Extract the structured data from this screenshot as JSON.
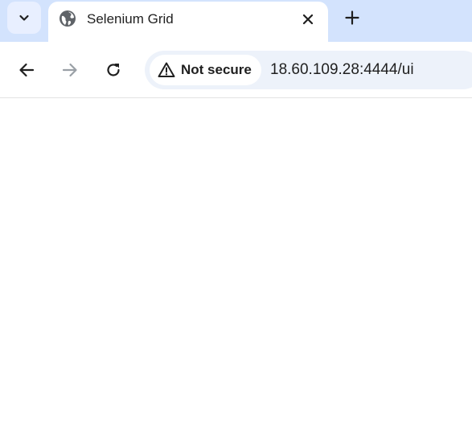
{
  "tab": {
    "title": "Selenium Grid"
  },
  "address_bar": {
    "security_label": "Not secure",
    "url": "18.60.109.28:4444/ui"
  },
  "icons": {
    "tab_search": "chevron-down-icon",
    "favicon": "globe-icon",
    "tab_close": "close-icon",
    "new_tab": "plus-icon",
    "back": "arrow-left-icon",
    "forward": "arrow-right-icon",
    "reload": "reload-icon",
    "security": "warning-triangle-icon"
  },
  "colors": {
    "tabstrip_bg": "#d3e3fd",
    "omnibox_bg": "#edf2fa",
    "text": "#1f1f1f",
    "disabled": "#9aa0a6"
  }
}
